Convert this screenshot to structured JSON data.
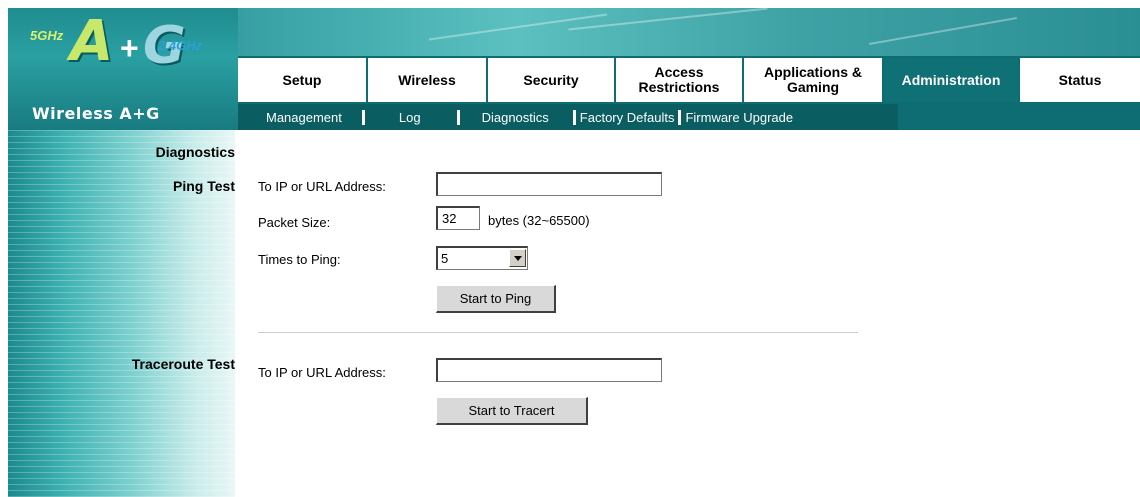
{
  "logo": {
    "band_5ghz": "5GHz",
    "letter_a": "A",
    "plus": "+",
    "letter_g": "G",
    "band_24ghz": "2.4GHz",
    "product_name": "Wireless A+G"
  },
  "main_tabs": [
    {
      "label": "Setup"
    },
    {
      "label": "Wireless"
    },
    {
      "label": "Security"
    },
    {
      "label": "Access Restrictions"
    },
    {
      "label": "Applications & Gaming"
    },
    {
      "label": "Administration",
      "active": true
    },
    {
      "label": "Status"
    }
  ],
  "sub_nav": {
    "management": "Management",
    "log": "Log",
    "diagnostics": "Diagnostics",
    "factory_defaults": "Factory Defaults",
    "firmware_upgrade": "Firmware Upgrade"
  },
  "sidebar": {
    "section_title": "Diagnostics",
    "ping_test": "Ping Test",
    "traceroute_test": "Traceroute Test"
  },
  "ping": {
    "address_label": "To IP or URL Address:",
    "address_value": "",
    "packet_size_label": "Packet Size:",
    "packet_size_value": "32",
    "packet_size_hint": "bytes (32~65500)",
    "times_label": "Times to Ping:",
    "times_value": "5",
    "start_button": "Start to Ping"
  },
  "traceroute": {
    "address_label": "To IP or URL Address:",
    "address_value": "",
    "start_button": "Start to Tracert"
  },
  "colors": {
    "header_teal": "#0d6d72",
    "subnav_teal": "#0a5d61",
    "logo_lime": "#c7e86b"
  }
}
